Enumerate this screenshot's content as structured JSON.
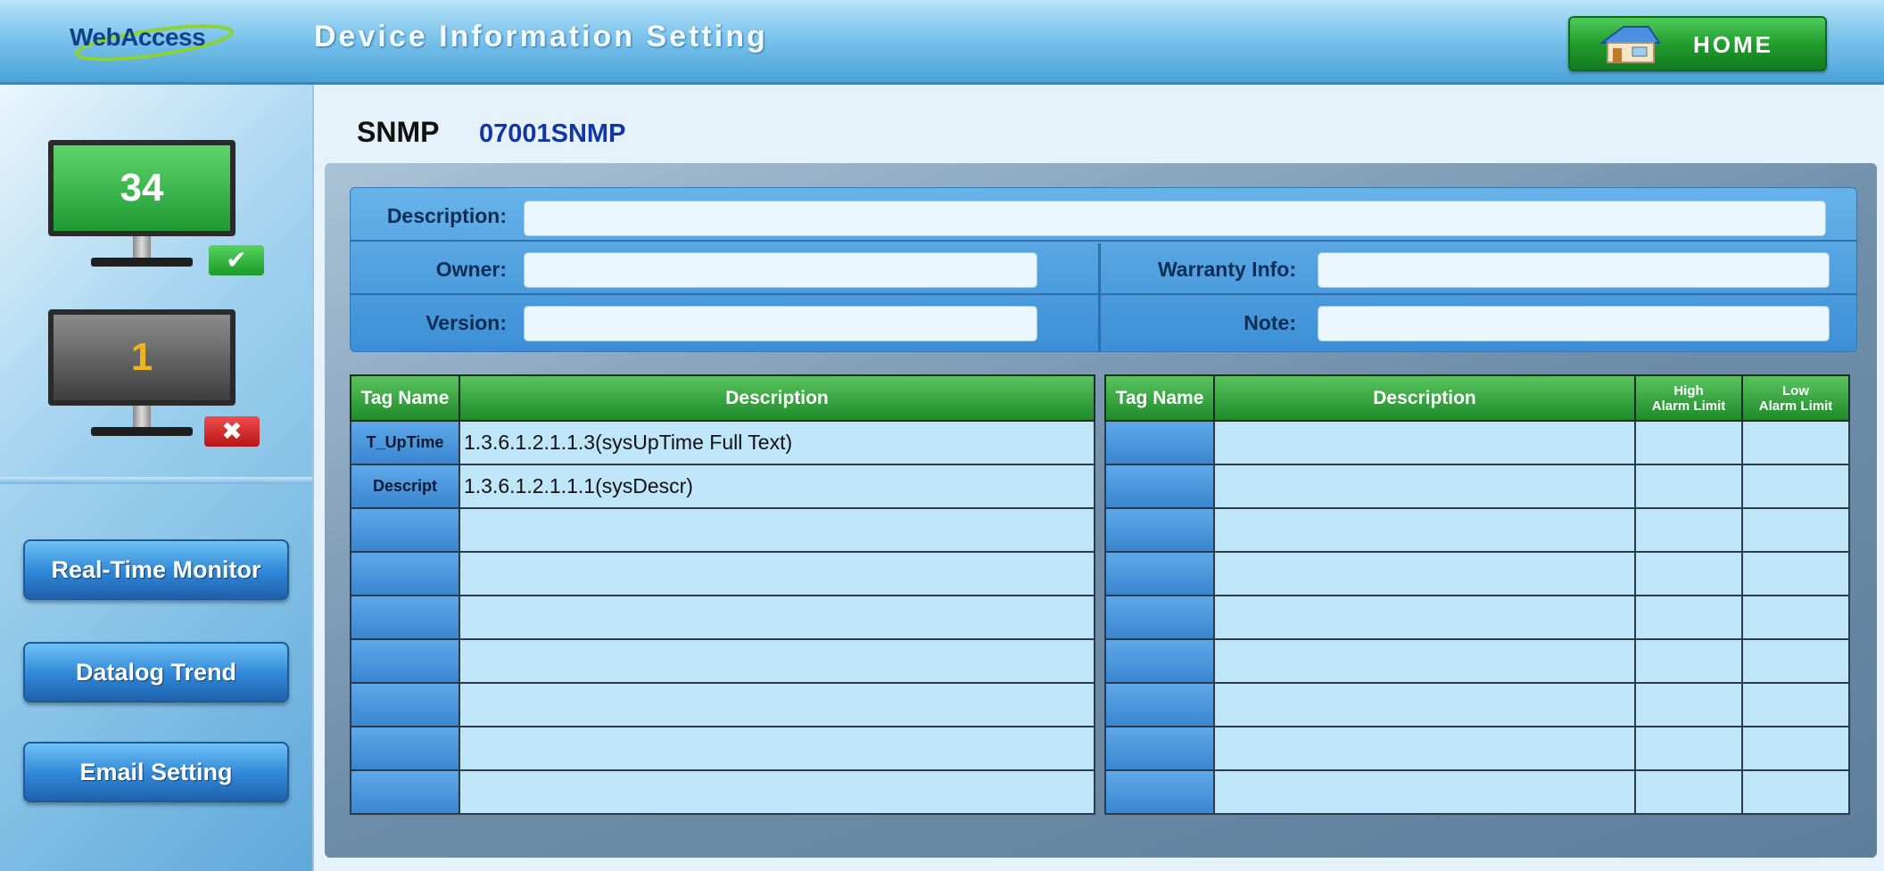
{
  "header": {
    "logo_text": "WebAccess",
    "title": "Device Information Setting",
    "home_label": "HOME"
  },
  "sidebar": {
    "ok_count": "34",
    "fault_count": "1",
    "ok_badge_icon": "check-icon",
    "fault_badge_icon": "x-icon",
    "buttons": [
      "Real-Time Monitor",
      "Datalog Trend",
      "Email Setting"
    ]
  },
  "device": {
    "type": "SNMP",
    "name": "07001SNMP"
  },
  "form": {
    "description_label": "Description:",
    "description_value": "",
    "owner_label": "Owner:",
    "owner_value": "",
    "warranty_label": "Warranty Info:",
    "warranty_value": "",
    "version_label": "Version:",
    "version_value": "",
    "note_label": "Note:",
    "note_value": ""
  },
  "left_table": {
    "headers": [
      "Tag Name",
      "Description"
    ],
    "rows": [
      {
        "tag": "T_UpTime",
        "desc": "1.3.6.1.2.1.1.3(sysUpTime Full Text)"
      },
      {
        "tag": "Descript",
        "desc": "1.3.6.1.2.1.1.1(sysDescr)"
      },
      {
        "tag": "",
        "desc": ""
      },
      {
        "tag": "",
        "desc": ""
      },
      {
        "tag": "",
        "desc": ""
      },
      {
        "tag": "",
        "desc": ""
      },
      {
        "tag": "",
        "desc": ""
      },
      {
        "tag": "",
        "desc": ""
      },
      {
        "tag": "",
        "desc": ""
      }
    ]
  },
  "right_table": {
    "headers": [
      "Tag Name",
      "Description"
    ],
    "high_line1": "High",
    "high_line2": "Alarm Limit",
    "low_line1": "Low",
    "low_line2": "Alarm Limit",
    "rows": [
      {
        "tag": "",
        "desc": "",
        "high": "",
        "low": ""
      },
      {
        "tag": "",
        "desc": "",
        "high": "",
        "low": ""
      },
      {
        "tag": "",
        "desc": "",
        "high": "",
        "low": ""
      },
      {
        "tag": "",
        "desc": "",
        "high": "",
        "low": ""
      },
      {
        "tag": "",
        "desc": "",
        "high": "",
        "low": ""
      },
      {
        "tag": "",
        "desc": "",
        "high": "",
        "low": ""
      },
      {
        "tag": "",
        "desc": "",
        "high": "",
        "low": ""
      },
      {
        "tag": "",
        "desc": "",
        "high": "",
        "low": ""
      },
      {
        "tag": "",
        "desc": "",
        "high": "",
        "low": ""
      }
    ]
  },
  "colors": {
    "header_blue": "#4aa2d8",
    "table_header_green": "#1e8c2a",
    "tag_cell_blue": "#3a86d0",
    "desc_cell": "#bfe5f9",
    "home_green": "#1e9a2c"
  }
}
